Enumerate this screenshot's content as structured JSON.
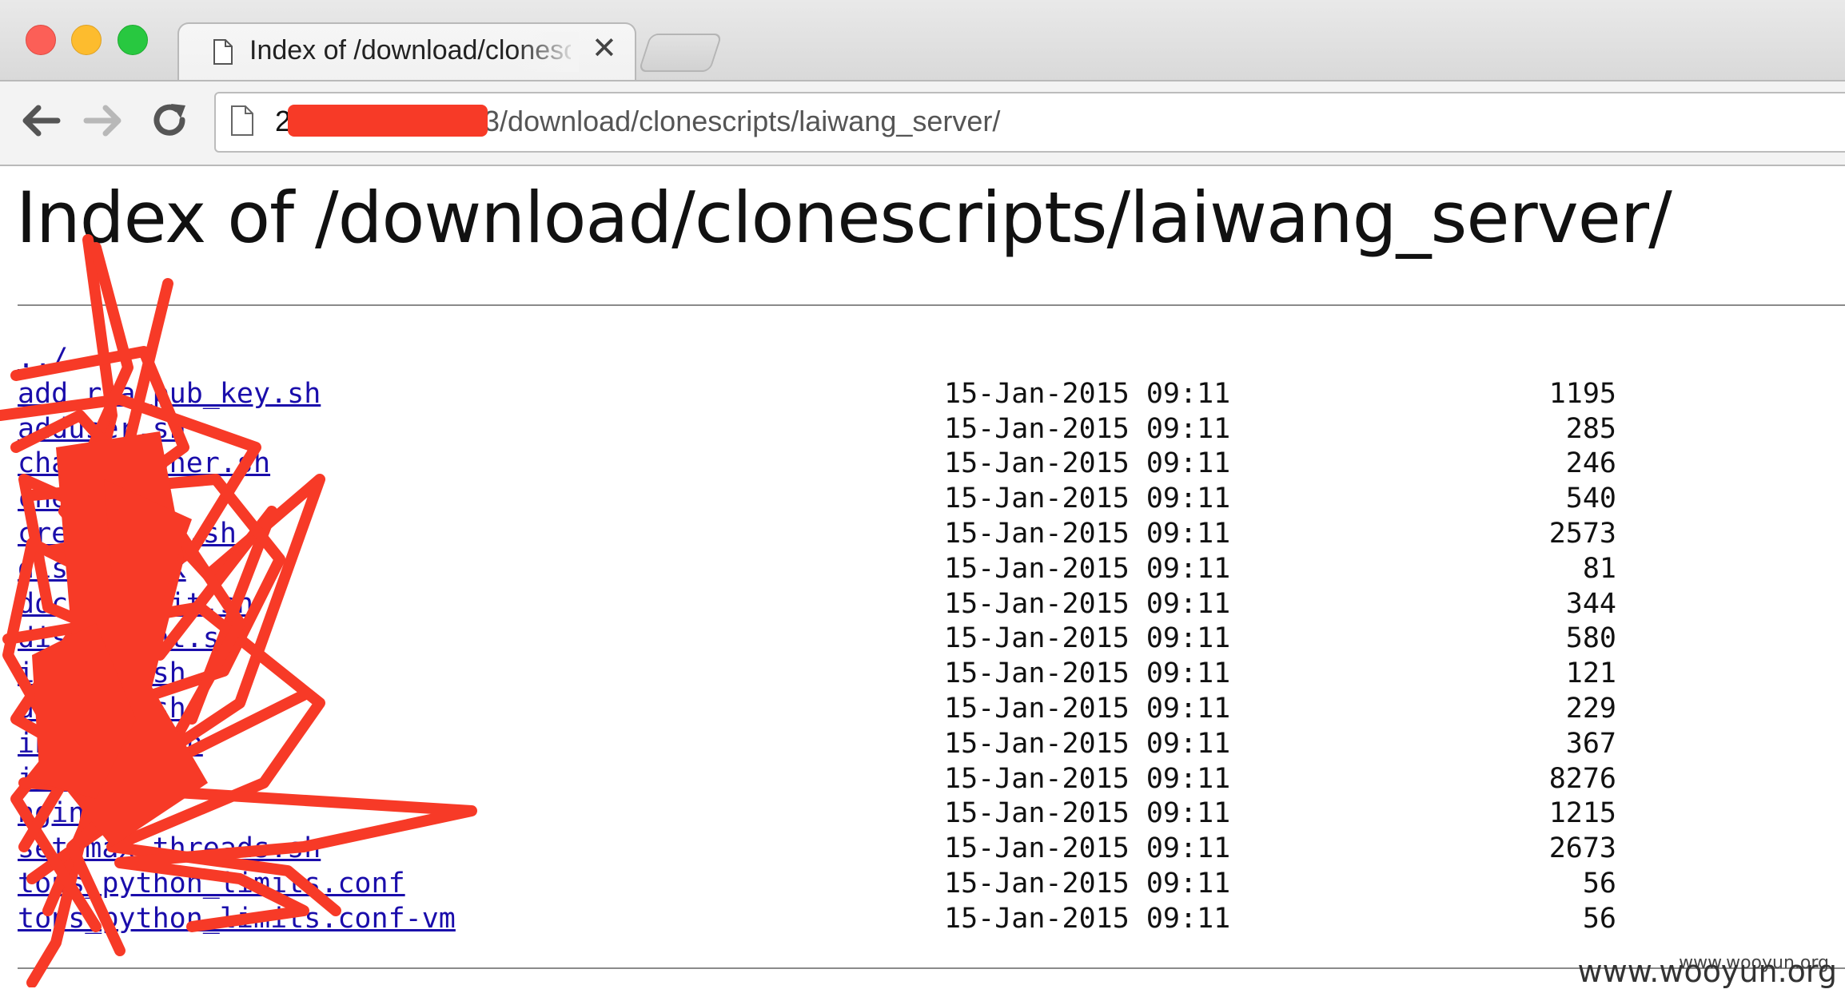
{
  "tab": {
    "title": "Index of /download/clonescripts/laiwang_server/"
  },
  "omnibox": {
    "url_host_visible": "2",
    "url_path": "3/download/clonescripts/laiwang_server/"
  },
  "page": {
    "heading": "Index of /download/clonescripts/laiwang_server/",
    "parent_link": "../",
    "entries": [
      {
        "name": "add_rsa_pub_key.sh",
        "date": "15-Jan-2015 09:11",
        "size": "1195"
      },
      {
        "name": "adduser.sh",
        "date": "15-Jan-2015 09:11",
        "size": "285"
      },
      {
        "name": "change_owner.sh",
        "date": "15-Jan-2015 09:11",
        "size": "246"
      },
      {
        "name": "check.sh",
        "date": "15-Jan-2015 09:11",
        "size": "540"
      },
      {
        "name": "create_sql.sh",
        "date": "15-Jan-2015 09:11",
        "size": "2573"
      },
      {
        "name": "disk_check",
        "date": "15-Jan-2015 09:11",
        "size": "81"
      },
      {
        "name": "docker_init.sh",
        "date": "15-Jan-2015 09:11",
        "size": "344"
      },
      {
        "name": "disk_mount.sh",
        "date": "15-Jan-2015 09:11",
        "size": "580"
      },
      {
        "name": "install.sh",
        "date": "15-Jan-2015 09:11",
        "size": "121"
      },
      {
        "name": "do_user.sh",
        "date": "15-Jan-2015 09:11",
        "size": "229"
      },
      {
        "name": "init_env.sh",
        "date": "15-Jan-2015 09:11",
        "size": "367"
      },
      {
        "name": "install",
        "date": "15-Jan-2015 09:11",
        "size": "8276"
      },
      {
        "name": "nginx",
        "date": "15-Jan-2015 09:11",
        "size": "1215"
      },
      {
        "name": "set_max_threads.sh",
        "date": "15-Jan-2015 09:11",
        "size": "2673"
      },
      {
        "name": "tops_python_limits.conf",
        "date": "15-Jan-2015 09:11",
        "size": "56"
      },
      {
        "name": "tops_python_limits.conf-vm",
        "date": "15-Jan-2015 09:11",
        "size": "56"
      }
    ]
  },
  "watermark": "www.wooyun.org",
  "colors": {
    "redaction": "#f73a27",
    "link": "#1a0dab"
  }
}
